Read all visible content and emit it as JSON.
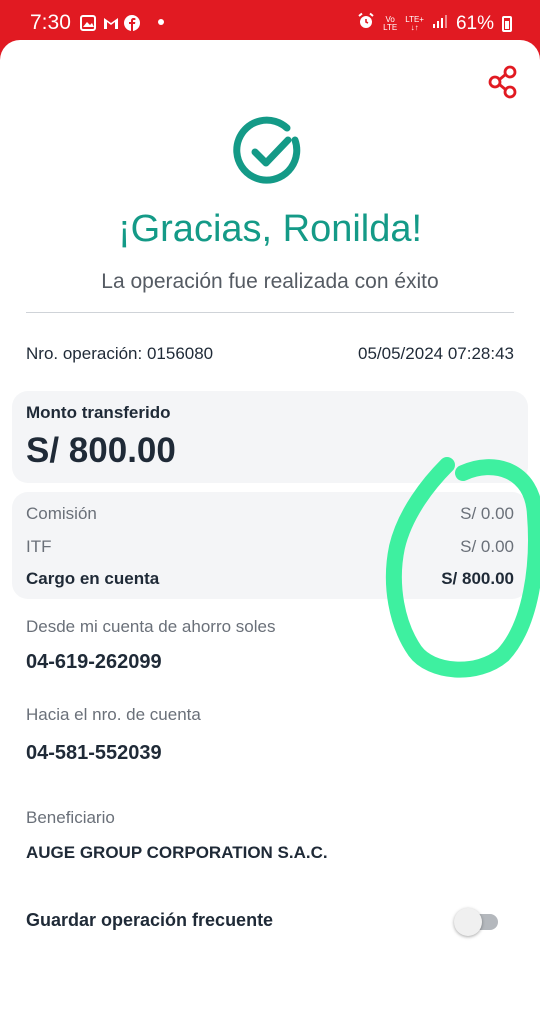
{
  "status_bar": {
    "time": "7:30",
    "battery": "61%",
    "network_top": "LTE+",
    "volte_top": "Vo",
    "volte_bottom": "LTE"
  },
  "header": {
    "share_icon": "share-icon",
    "success_icon": "check-circle-icon",
    "title": "¡Gracias, Ronilda!",
    "subtitle": "La operación fue realizada con éxito"
  },
  "operation": {
    "number_label": "Nro. operación: 0156080",
    "datetime": "05/05/2024 07:28:43"
  },
  "amount": {
    "label": "Monto transferido",
    "value": "S/ 800.00"
  },
  "fees": [
    {
      "label": "Comisión",
      "value": "S/ 0.00"
    },
    {
      "label": "ITF",
      "value": "S/ 0.00"
    },
    {
      "label": "Cargo en cuenta",
      "value": "S/ 800.00"
    }
  ],
  "from_account": {
    "label": "Desde mi cuenta de ahorro soles",
    "value": "04-619-262099"
  },
  "to_account": {
    "label": "Hacia el nro. de cuenta",
    "value": "04-581-552039"
  },
  "beneficiary": {
    "label": "Beneficiario",
    "value": "AUGE GROUP CORPORATION S.A.C."
  },
  "save_frequent": {
    "label": "Guardar operación frecuente",
    "enabled": false
  },
  "colors": {
    "brand_red": "#e11a22",
    "success_teal": "#149a87",
    "annotation_green": "#3ef0a0"
  }
}
